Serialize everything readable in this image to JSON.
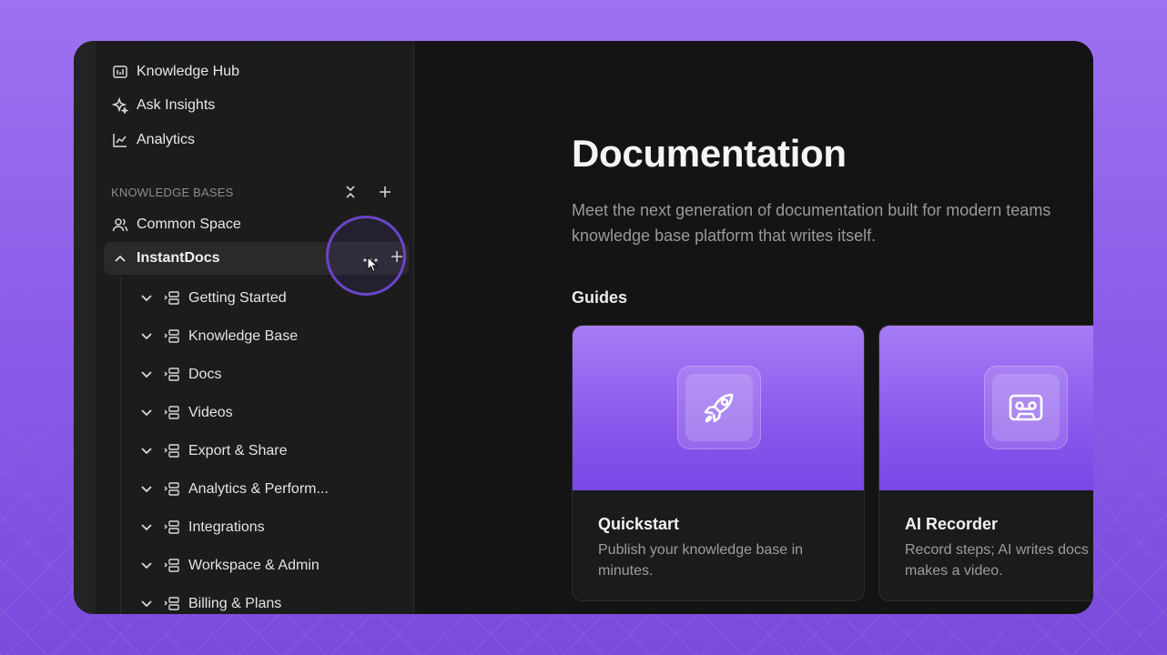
{
  "nav": {
    "items": [
      {
        "label": "Knowledge Hub",
        "icon": "knowledge-hub-icon"
      },
      {
        "label": "Ask Insights",
        "icon": "sparkle-icon"
      },
      {
        "label": "Analytics",
        "icon": "line-chart-icon"
      }
    ]
  },
  "knowledge_bases": {
    "header": "KNOWLEDGE BASES",
    "items": [
      {
        "label": "Common Space",
        "icon": "users-icon"
      },
      {
        "label": "InstantDocs",
        "icon": "chevron-up-icon",
        "expanded": true,
        "actions": [
          "more-icon",
          "plus-icon"
        ]
      }
    ],
    "tree": [
      {
        "label": "Getting Started"
      },
      {
        "label": "Knowledge Base"
      },
      {
        "label": "Docs"
      },
      {
        "label": "Videos"
      },
      {
        "label": "Export & Share"
      },
      {
        "label": "Analytics & Perform..."
      },
      {
        "label": "Integrations"
      },
      {
        "label": "Workspace & Admin"
      },
      {
        "label": "Billing & Plans"
      }
    ]
  },
  "main": {
    "title": "Documentation",
    "intro_line1": "Meet the next generation of documentation built for modern teams",
    "intro_line2": "knowledge base platform that writes itself.",
    "guides_title": "Guides",
    "cards": [
      {
        "title": "Quickstart",
        "desc_line1": "Publish your knowledge base in",
        "desc_line2": "minutes.",
        "icon": "rocket-icon"
      },
      {
        "title": "AI Recorder",
        "desc_line1": "Record steps; AI writes docs",
        "desc_line2": "makes a video.",
        "icon": "recorder-icon"
      }
    ]
  },
  "colors": {
    "accent": "#8a58ec",
    "highlight_ring": "#6b45c9",
    "background": "#9c72f0"
  }
}
